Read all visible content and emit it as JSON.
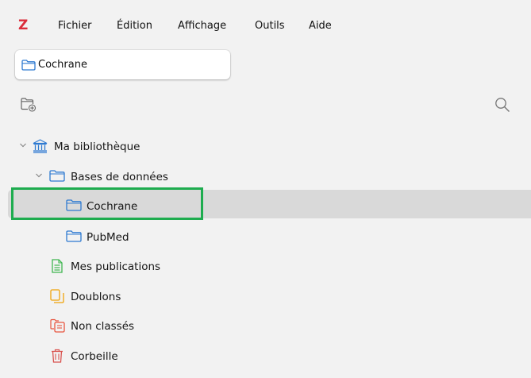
{
  "app": {
    "logo": "Z",
    "brand_color": "#db2c3a"
  },
  "menu": {
    "items": [
      "Fichier",
      "Édition",
      "Affichage",
      "Outils",
      "Aide"
    ]
  },
  "tabs": [
    {
      "label": "Cochrane",
      "icon": "folder-icon"
    }
  ],
  "toolbar": {
    "new_collection_icon": "new-collection-icon",
    "search_icon": "search-icon"
  },
  "tree": {
    "library": {
      "label": "Ma bibliothèque",
      "icon": "library-icon",
      "expanded": true
    },
    "databases": {
      "label": "Bases de données",
      "icon": "folder-icon",
      "expanded": true
    },
    "cochrane": {
      "label": "Cochrane",
      "icon": "folder-icon",
      "selected": true
    },
    "pubmed": {
      "label": "PubMed",
      "icon": "folder-icon"
    },
    "publications": {
      "label": "Mes publications",
      "icon": "publications-icon"
    },
    "duplicates": {
      "label": "Doublons",
      "icon": "duplicates-icon"
    },
    "unfiled": {
      "label": "Non classés",
      "icon": "unfiled-icon"
    },
    "trash": {
      "label": "Corbeille",
      "icon": "trash-icon"
    }
  },
  "colors": {
    "folder_blue": "#2e7ad1",
    "highlight_green": "#1eac4f",
    "selection_bg": "#d9d9d9",
    "publications_green": "#3fb650",
    "duplicates_yellow": "#f0a30a",
    "unfiled_red": "#e8553f",
    "trash_red": "#d9534f"
  }
}
